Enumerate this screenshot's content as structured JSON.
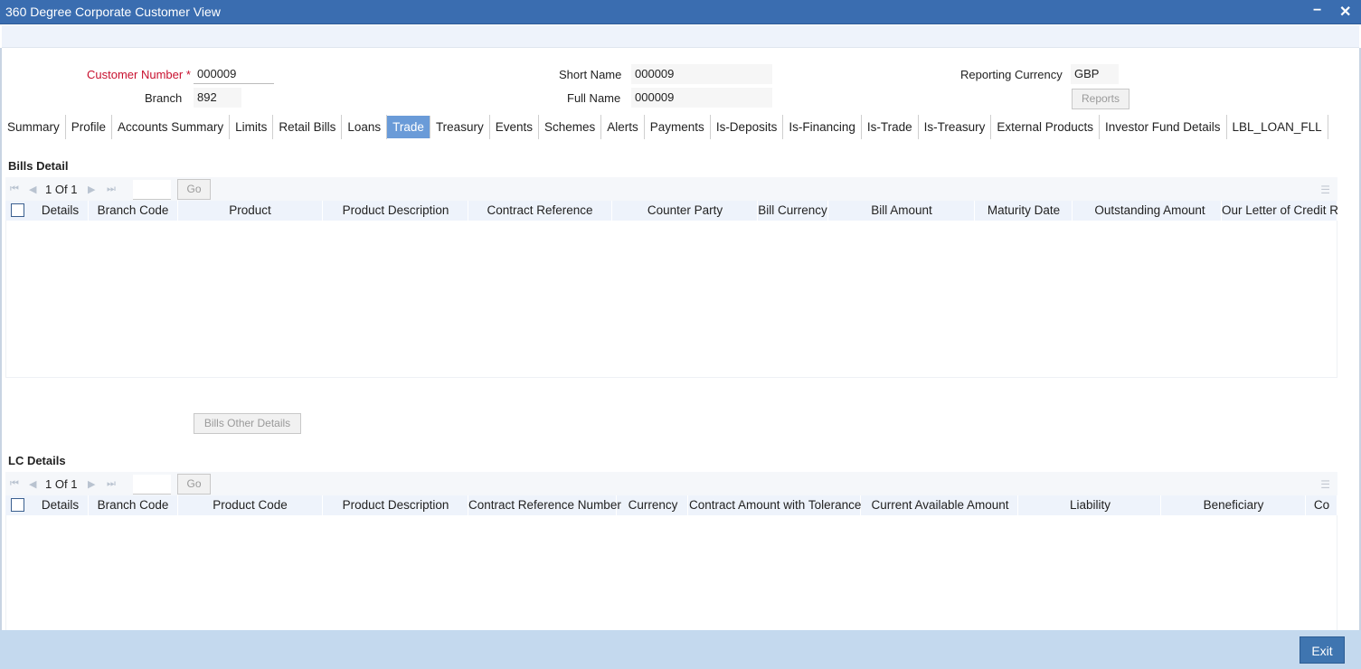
{
  "window": {
    "title": "360 Degree Corporate Customer View",
    "minimize_icon": "minimize-icon",
    "close_icon": "close-icon"
  },
  "header": {
    "customer_number_label": "Customer Number",
    "required_mark": "*",
    "customer_number_value": "000009",
    "branch_label": "Branch",
    "branch_value": "892",
    "short_name_label": "Short Name",
    "short_name_value": "000009",
    "full_name_label": "Full Name",
    "full_name_value": "000009",
    "reporting_currency_label": "Reporting Currency",
    "reporting_currency_value": "GBP",
    "reports_button": "Reports"
  },
  "tabs": [
    {
      "label": "Summary"
    },
    {
      "label": "Profile"
    },
    {
      "label": "Accounts Summary"
    },
    {
      "label": "Limits"
    },
    {
      "label": "Retail Bills"
    },
    {
      "label": "Loans"
    },
    {
      "label": "Trade",
      "active": true
    },
    {
      "label": "Treasury"
    },
    {
      "label": "Events"
    },
    {
      "label": "Schemes"
    },
    {
      "label": "Alerts"
    },
    {
      "label": "Payments"
    },
    {
      "label": "Is-Deposits"
    },
    {
      "label": "Is-Financing"
    },
    {
      "label": "Is-Trade"
    },
    {
      "label": "Is-Treasury"
    },
    {
      "label": "External Products"
    },
    {
      "label": "Investor Fund Details"
    },
    {
      "label": "LBL_LOAN_FLL"
    }
  ],
  "bills": {
    "title": "Bills Detail",
    "pager": {
      "current": "1",
      "of_label": "Of",
      "total": "1",
      "go_label": "Go"
    },
    "columns": [
      "Details",
      "Branch Code",
      "Product",
      "Product Description",
      "Contract Reference",
      "Counter Party",
      "Bill Currency",
      "Bill Amount",
      "Maturity Date",
      "Outstanding Amount",
      "Our Letter of Credit Ref"
    ],
    "other_details_button": "Bills Other Details"
  },
  "lc": {
    "title": "LC Details",
    "pager": {
      "current": "1",
      "of_label": "Of",
      "total": "1",
      "go_label": "Go"
    },
    "columns": [
      "Details",
      "Branch Code",
      "Product Code",
      "Product Description",
      "Contract Reference Number",
      "Currency",
      "Contract Amount with Tolerance",
      "Current Available Amount",
      "Liability",
      "Beneficiary",
      "Co"
    ]
  },
  "footer": {
    "exit_button": "Exit"
  },
  "colors": {
    "titlebar": "#3a6db0",
    "active_tab": "#6a9bd8",
    "required_label": "#c8102e",
    "footer": "#c4d9ee",
    "exit_button": "#3f75b0"
  }
}
